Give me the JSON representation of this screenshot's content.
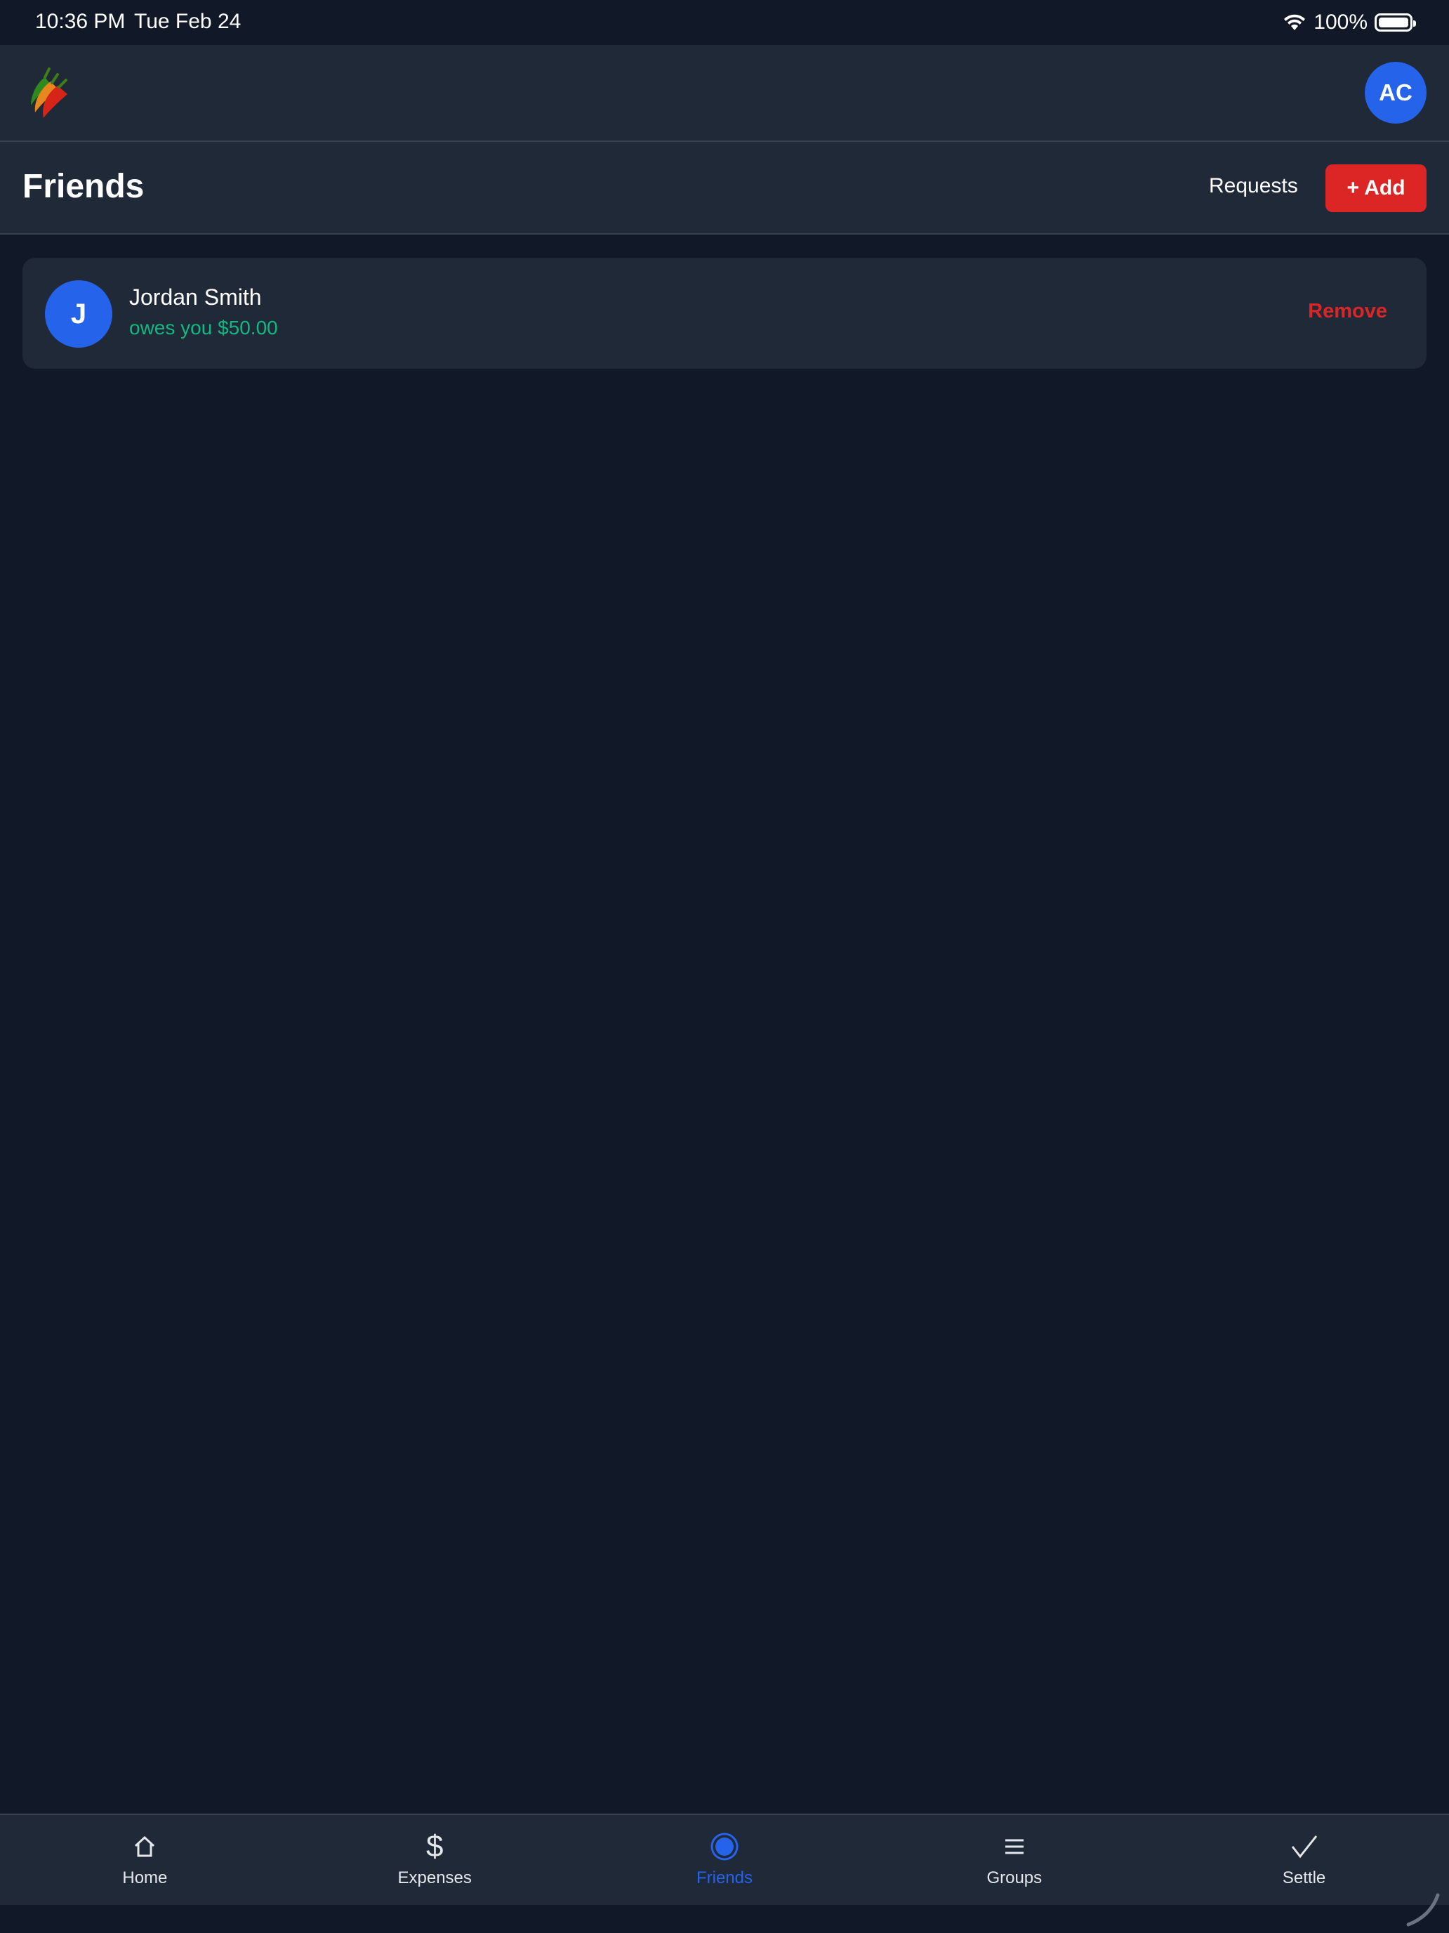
{
  "status_bar": {
    "time": "10:36 PM",
    "date": "Tue Feb 24",
    "battery": "100%"
  },
  "header": {
    "logo_icon": "chili-pepper-icon",
    "user_initials": "AC"
  },
  "page": {
    "title": "Friends",
    "requests_label": "Requests",
    "add_label": "+ Add"
  },
  "friends": [
    {
      "initial": "J",
      "name": "Jordan Smith",
      "balance_text": "owes you $50.00",
      "remove_label": "Remove"
    }
  ],
  "tabs": [
    {
      "label": "Home",
      "icon": "home-icon"
    },
    {
      "label": "Expenses",
      "icon": "dollar-icon"
    },
    {
      "label": "Friends",
      "icon": "friends-dot-icon",
      "active": true
    },
    {
      "label": "Groups",
      "icon": "menu-icon"
    },
    {
      "label": "Settle",
      "icon": "checkmark-icon"
    }
  ],
  "colors": {
    "background": "#111827",
    "surface": "#1f2937",
    "accent": "#2563eb",
    "danger": "#dc2626",
    "positive": "#10b981"
  }
}
